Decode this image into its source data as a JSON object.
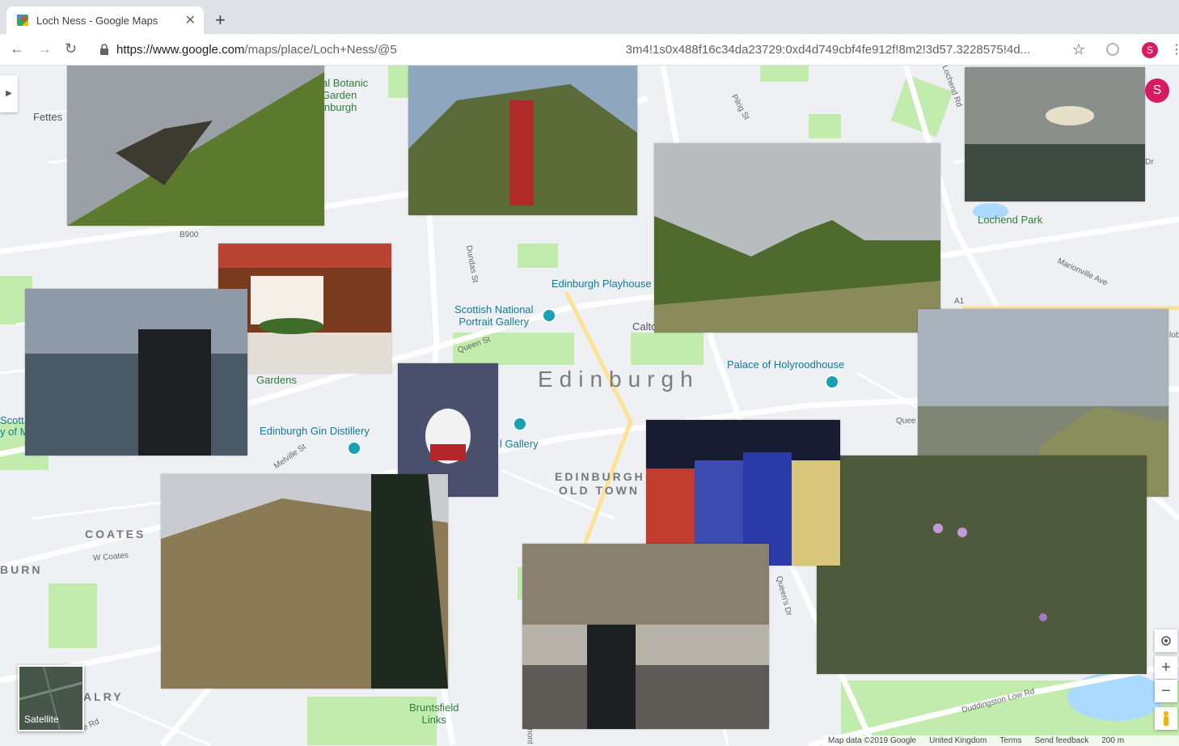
{
  "browser": {
    "tab_title": "Loch Ness - Google Maps",
    "new_tab": "+",
    "close": "✕",
    "url_main": "https://www.google.com",
    "url_rest_a": "/maps/place/Loch+Ness/@5",
    "url_rest_b": "3m4!1s0x488f16c34da23729:0xd4d749cbf4fe912f!8m2!3d57.3228575!4d...",
    "profile_initial": "S"
  },
  "map": {
    "labels": {
      "fettes": "Fettes",
      "botanic": "al Botanic\nGarden\ninburgh",
      "b900": "B900",
      "dundas": "Dundas St",
      "pilrig": "Pilrig St",
      "lochend_rd": "Lochend Rd",
      "lochend_park": "Lochend Park",
      "marionville": "Marionville Ave",
      "a1": "A1",
      "playhouse": "Edinburgh Playhouse",
      "portrait": "Scottish National\nPortrait Gallery",
      "calton": "Calto",
      "queen_st": "Queen St",
      "gardens": "Gardens",
      "edinburgh": "Edinburgh",
      "holyrood": "Palace of Holyroodhouse",
      "gin": "Edinburgh Gin Distillery",
      "melville": "Melville St",
      "gallery": "l Gallery",
      "old_town_1": "EDINBURGH",
      "old_town_2": "OLD TOWN",
      "coates": "COATES",
      "w_coates": "W Coates",
      "burn": "BURN",
      "scott": "Scott\ny of M",
      "alry": "ALRY",
      "gorgie": "ie Rd",
      "bruntsfield": "Bruntsfield\nLinks",
      "queens_dr": "Queen's Dr",
      "duddingston": "Duddingston Low Rd",
      "queen_edge": "Quee",
      "dr": "Dr",
      "lobe": "lobe",
      "mont": "mont"
    },
    "satellite_label": "Satellite",
    "footer": {
      "map_data": "Map data ©2019 Google",
      "region": "United Kingdom",
      "terms": "Terms",
      "feedback": "Send feedback",
      "scale": "200 m"
    },
    "controls": {
      "zoom_in": "+",
      "zoom_out": "−"
    }
  },
  "icons": [
    "maps-favicon",
    "back-icon",
    "forward-icon",
    "reload-icon",
    "lock-icon",
    "star-icon",
    "extension-icon",
    "menu-icon",
    "my-location-icon",
    "pegman-icon",
    "expand-icon"
  ],
  "colors": {
    "park": "#c2ecae",
    "road": "#ffffff",
    "water": "#aadaff",
    "poi": "#19a0b5",
    "profile": "#d81b60"
  }
}
